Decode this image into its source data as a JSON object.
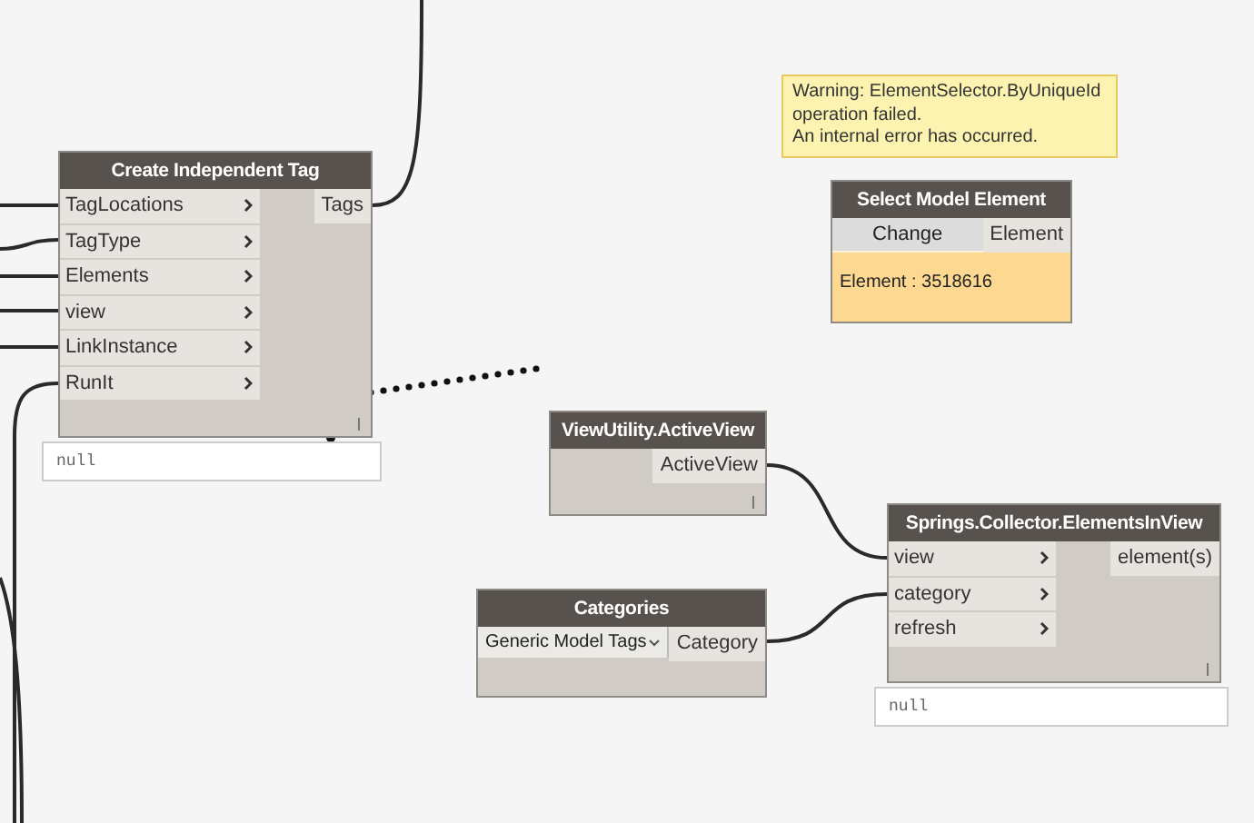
{
  "warning": {
    "lines": [
      "Warning: ElementSelector.ByUniqueId",
      "operation failed.",
      "An internal error has occurred."
    ]
  },
  "nodes": [
    {
      "kind": "function",
      "title": "Create Independent Tag",
      "inputs": [
        "TagLocations",
        "TagType",
        "Elements",
        "view",
        "LinkInstance",
        "RunIt"
      ],
      "outputs": [
        "Tags"
      ],
      "preview": "null"
    },
    {
      "kind": "selector",
      "title": "Select Model Element",
      "button": "Change",
      "outputs": [
        "Element"
      ],
      "value": "Element : 3518616"
    },
    {
      "kind": "function",
      "title": "ViewUtility.ActiveView",
      "outputs": [
        "ActiveView"
      ]
    },
    {
      "kind": "function",
      "title": "Springs.Collector.ElementsInView",
      "inputs": [
        "view",
        "category",
        "refresh"
      ],
      "outputs": [
        "element(s)"
      ],
      "preview": "null"
    },
    {
      "kind": "dropdown",
      "title": "Categories",
      "selection": "Generic Model Tags",
      "outputs": [
        "Category"
      ]
    }
  ]
}
